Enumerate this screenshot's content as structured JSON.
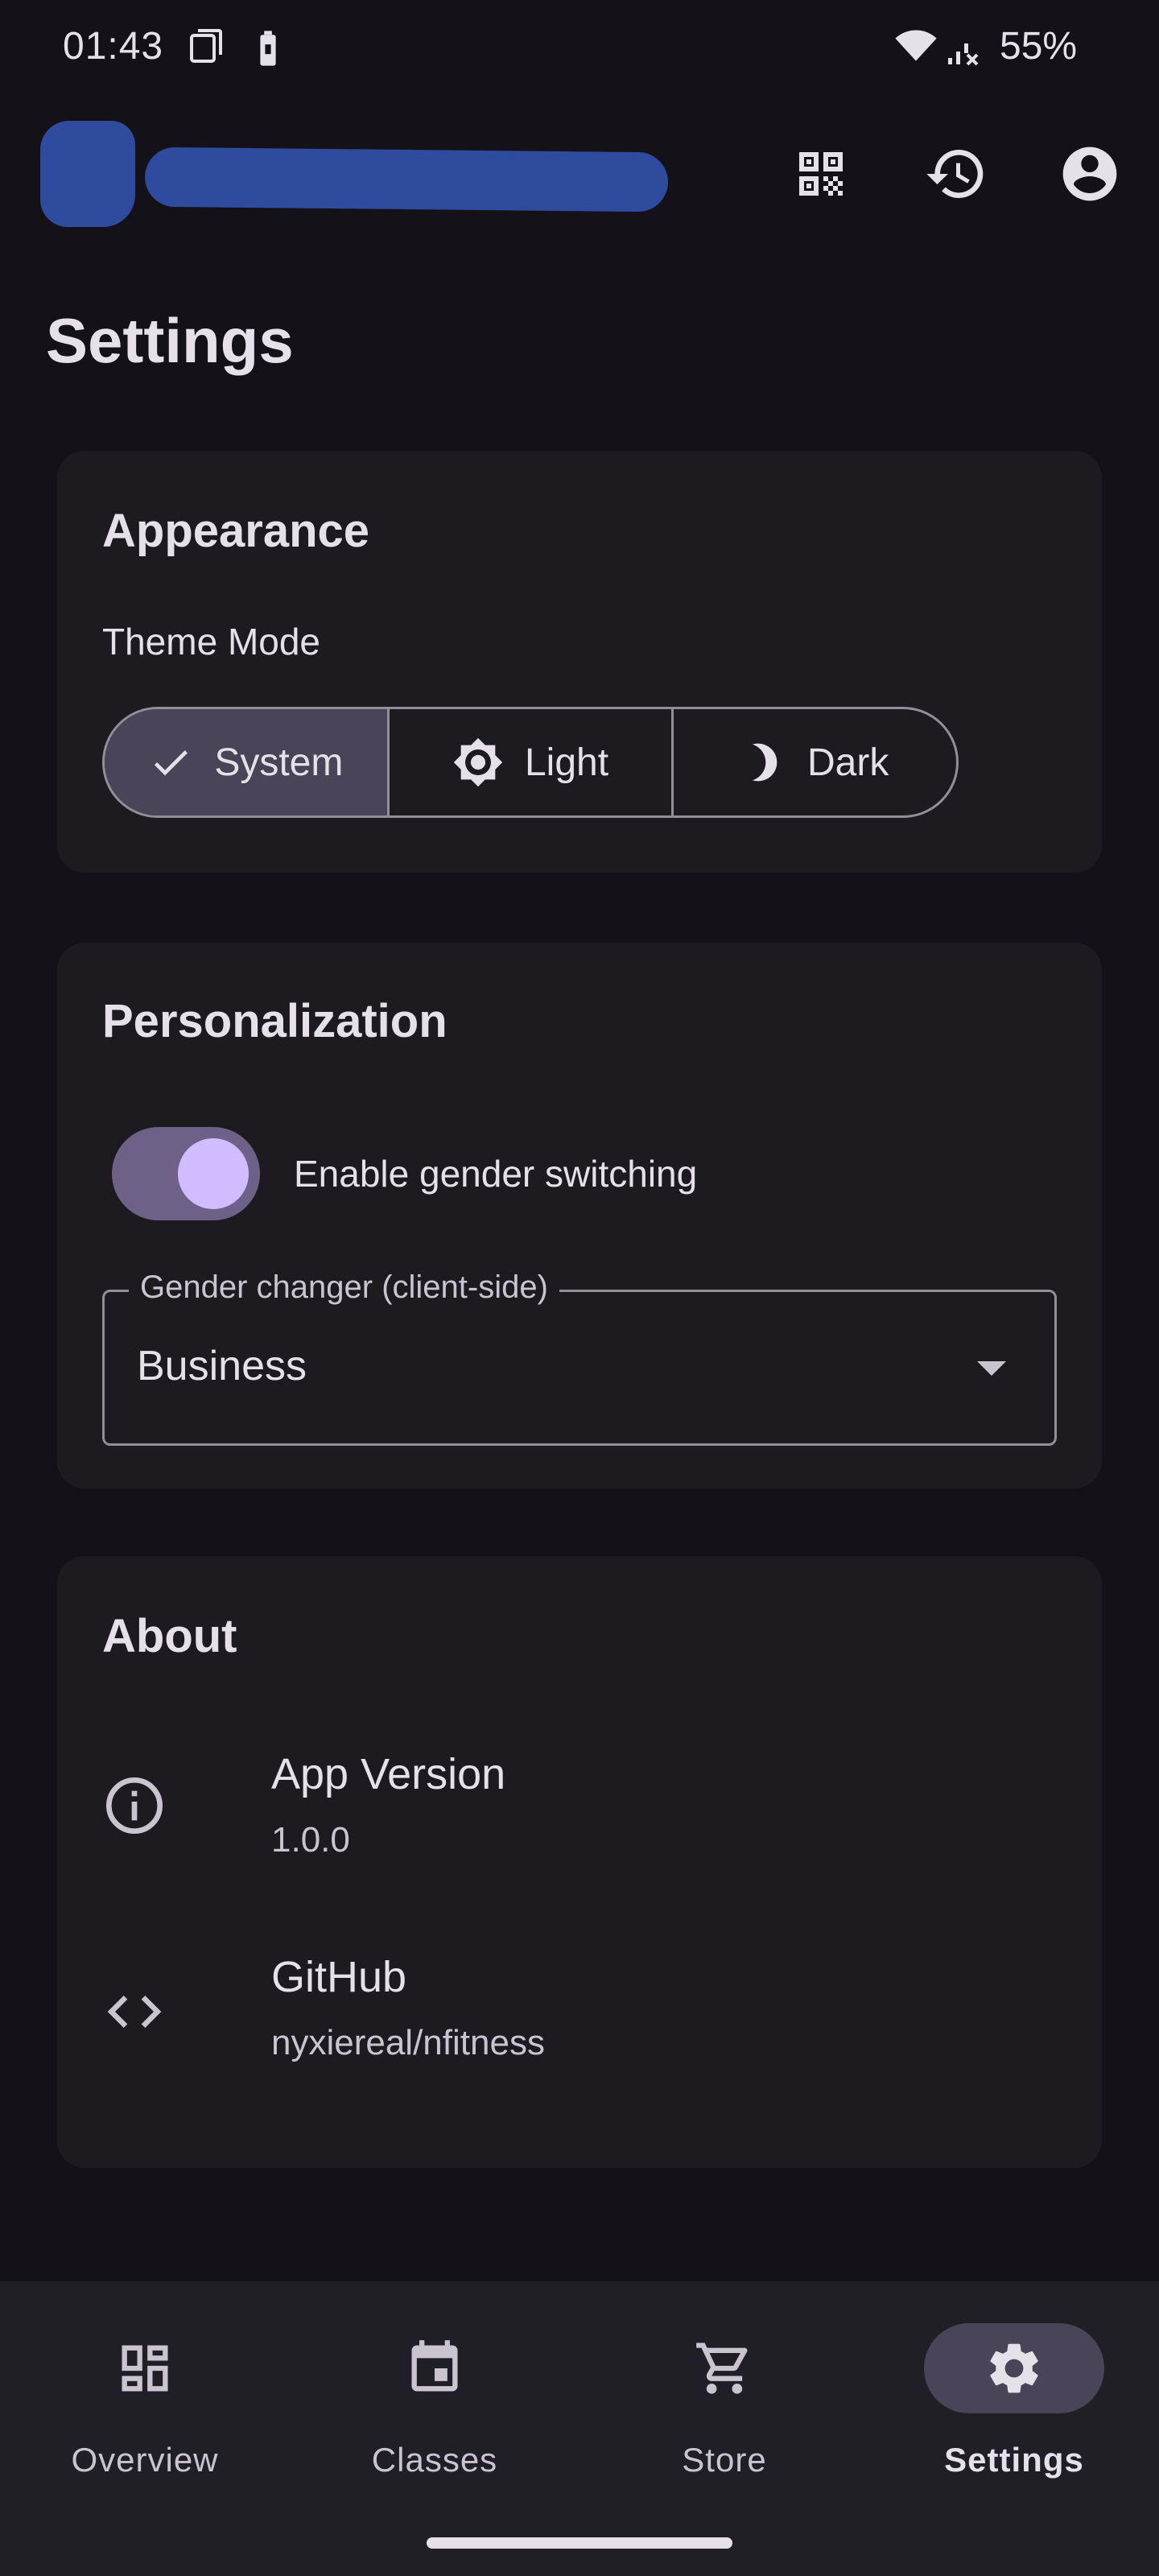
{
  "status_bar": {
    "time": "01:43",
    "battery": "55%"
  },
  "page": {
    "title": "Settings"
  },
  "appearance": {
    "title": "Appearance",
    "theme_mode_label": "Theme Mode",
    "options": [
      {
        "label": "System",
        "icon": "check-icon",
        "selected": true
      },
      {
        "label": "Light",
        "icon": "sun-icon",
        "selected": false
      },
      {
        "label": "Dark",
        "icon": "moon-icon",
        "selected": false
      }
    ]
  },
  "personalization": {
    "title": "Personalization",
    "switch_label": "Enable gender switching",
    "switch_on": true,
    "dropdown_label": "Gender changer (client-side)",
    "dropdown_value": "Business"
  },
  "about": {
    "title": "About",
    "items": [
      {
        "icon": "info-icon",
        "title": "App Version",
        "subtitle": "1.0.0"
      },
      {
        "icon": "code-icon",
        "title": "GitHub",
        "subtitle": "nyxiereal/nfitness"
      }
    ]
  },
  "nav": {
    "items": [
      {
        "label": "Overview",
        "icon": "dashboard-icon",
        "active": false
      },
      {
        "label": "Classes",
        "icon": "calendar-icon",
        "active": false
      },
      {
        "label": "Store",
        "icon": "cart-icon",
        "active": false
      },
      {
        "label": "Settings",
        "icon": "gear-icon",
        "active": true
      }
    ]
  },
  "colors": {
    "background": "#141218",
    "card": "#1D1B20",
    "accent": "#D0BCFF",
    "selected": "#4A4458",
    "logo_redaction": "#2F4B9E"
  }
}
